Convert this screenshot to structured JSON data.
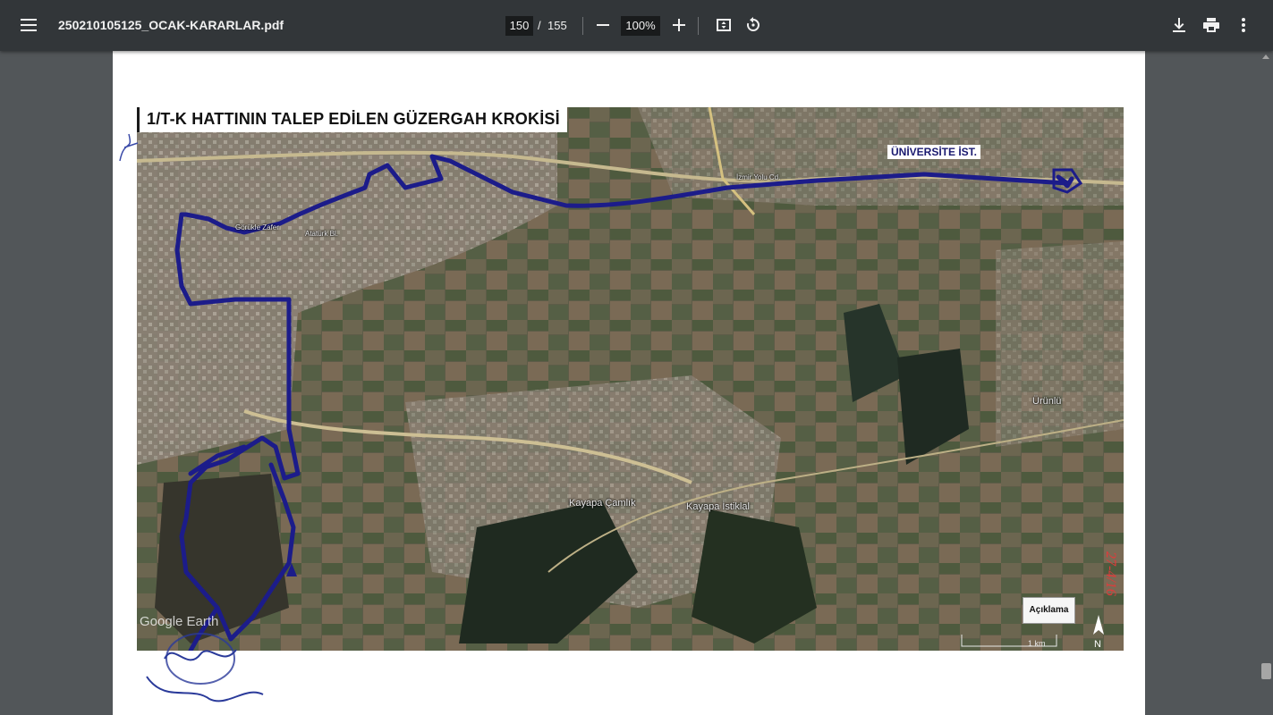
{
  "toolbar": {
    "menu_icon": "hamburger-menu-icon",
    "title": "250210105125_OCAK-KARARLAR.pdf",
    "current_page": "150",
    "page_separator": "/",
    "total_pages": "155",
    "zoom": "100%",
    "zoom_out_icon": "minus-icon",
    "zoom_in_icon": "plus-icon",
    "fit_icon": "fit-to-page-icon",
    "rotate_icon": "rotate-icon",
    "download_icon": "download-icon",
    "print_icon": "print-icon",
    "more_icon": "more-vertical-icon"
  },
  "document": {
    "map_title": "1/T-K HATTININ TALEP EDİLEN GÜZERGAH KROKİSİ",
    "university_label": "ÜNİVERSİTE İST.",
    "places": {
      "gorukle": "Görükle Zafer",
      "ataturk": "Atatürk Bl.",
      "izmir_yolu": "İzmir Yolu Cd.",
      "kayapa_camlik": "Kayapa Çamlık",
      "kayapa_istiklal": "Kayapa İstiklal",
      "unlulu": "Ürünlü"
    },
    "legend": "Açıklama",
    "google_label": "Google Earth",
    "scale": "1 km",
    "handwritten_date": "27-4/16",
    "route_color": "#1c1c8a",
    "map_base_color": "#5b5b4c"
  }
}
